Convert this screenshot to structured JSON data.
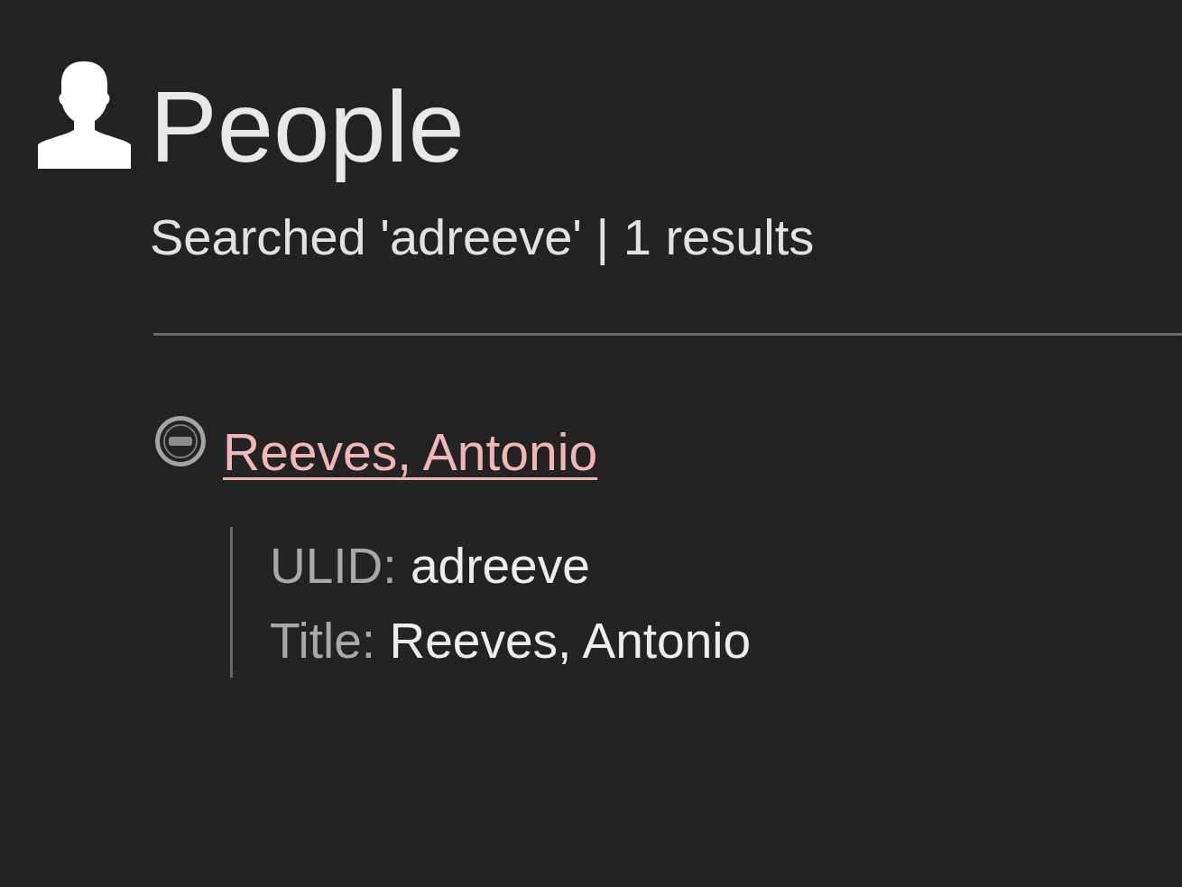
{
  "header": {
    "title": "People",
    "subtitle": "Searched 'adreeve' | 1 results"
  },
  "results": [
    {
      "name": "Reeves, Antonio",
      "fields": [
        {
          "label": "ULID:",
          "value": "adreeve"
        },
        {
          "label": "Title:",
          "value": "Reeves, Antonio"
        }
      ]
    }
  ]
}
